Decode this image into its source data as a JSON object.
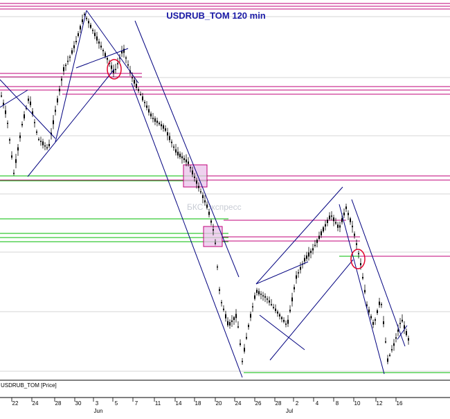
{
  "chart_data": {
    "type": "candlestick",
    "title": "USDRUB_TOM 120 min",
    "series_label": "USDRUB_TOM [Price]",
    "watermark": "БКС Экспресс",
    "x_tick_labels": [
      "22",
      "24",
      "28",
      "30",
      "3",
      "5",
      "7",
      "11",
      "14",
      "18",
      "20",
      "24",
      "26",
      "28",
      "2",
      "4",
      "8",
      "10",
      "12",
      "16"
    ],
    "month_labels": [
      "Jun",
      "Jul"
    ],
    "grid": "horizontal",
    "colors": {
      "candles": "#000000",
      "channels": "#00007f",
      "resistance": "#c0007a",
      "support": "#00bb00",
      "gridline": "#c8c8c8",
      "box_fill": "#e9c2ea",
      "circle": "#e0002a",
      "title": "#1a1aa6"
    }
  }
}
